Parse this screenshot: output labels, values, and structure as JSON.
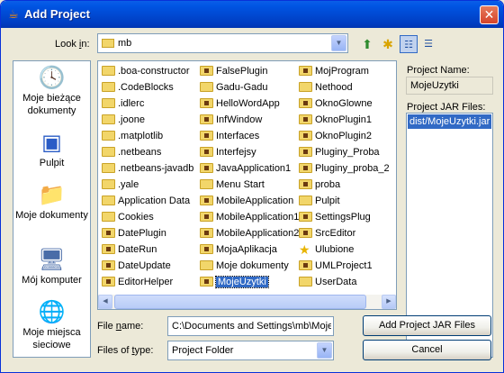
{
  "window": {
    "title": "Add Project",
    "close_symbol": "✕"
  },
  "lookin": {
    "label": "Look in:",
    "label_ul": "i",
    "value": "mb"
  },
  "places": [
    {
      "icon": "recent-documents-icon",
      "label": "Moje bieżące dokumenty"
    },
    {
      "icon": "desktop-icon",
      "label": "Pulpit"
    },
    {
      "icon": "my-documents-icon",
      "label": "Moje dokumenty"
    },
    {
      "icon": "my-computer-icon",
      "label": "Mój komputer"
    },
    {
      "icon": "network-places-icon",
      "label": "Moje miejsca sieciowe"
    }
  ],
  "files": {
    "col1": [
      {
        "name": ".boa-constructor",
        "icon": "folder"
      },
      {
        "name": ".CodeBlocks",
        "icon": "folder"
      },
      {
        "name": ".idlerc",
        "icon": "folder"
      },
      {
        "name": ".joone",
        "icon": "folder"
      },
      {
        "name": ".matplotlib",
        "icon": "folder"
      },
      {
        "name": ".netbeans",
        "icon": "folder"
      },
      {
        "name": ".netbeans-javadb",
        "icon": "folder"
      },
      {
        "name": ".yale",
        "icon": "folder"
      },
      {
        "name": "Application Data",
        "icon": "folder"
      },
      {
        "name": "Cookies",
        "icon": "folder"
      },
      {
        "name": "DatePlugin",
        "icon": "project"
      },
      {
        "name": "DateRun",
        "icon": "project"
      },
      {
        "name": "DateUpdate",
        "icon": "project"
      },
      {
        "name": "EditorHelper",
        "icon": "project"
      }
    ],
    "col2": [
      {
        "name": "FalsePlugin",
        "icon": "project"
      },
      {
        "name": "Gadu-Gadu",
        "icon": "folder"
      },
      {
        "name": "HelloWordApp",
        "icon": "project"
      },
      {
        "name": "InfWindow",
        "icon": "project"
      },
      {
        "name": "Interfaces",
        "icon": "project"
      },
      {
        "name": "Interfejsy",
        "icon": "project"
      },
      {
        "name": "JavaApplication1",
        "icon": "project"
      },
      {
        "name": "Menu Start",
        "icon": "folder"
      },
      {
        "name": "MobileApplication",
        "icon": "project"
      },
      {
        "name": "MobileApplication1",
        "icon": "project"
      },
      {
        "name": "MobileApplication2",
        "icon": "project"
      },
      {
        "name": "MojaAplikacja",
        "icon": "project"
      },
      {
        "name": "Moje dokumenty",
        "icon": "folder"
      },
      {
        "name": "MojeUzytki",
        "icon": "project",
        "selected": true
      }
    ],
    "col3": [
      {
        "name": "MojProgram",
        "icon": "project"
      },
      {
        "name": "Nethood",
        "icon": "folder"
      },
      {
        "name": "OknoGlowne",
        "icon": "project"
      },
      {
        "name": "OknoPlugin1",
        "icon": "project"
      },
      {
        "name": "OknoPlugin2",
        "icon": "project"
      },
      {
        "name": "Pluginy_Proba",
        "icon": "project"
      },
      {
        "name": "Pluginy_proba_2",
        "icon": "project"
      },
      {
        "name": "proba",
        "icon": "project"
      },
      {
        "name": "Pulpit",
        "icon": "folder"
      },
      {
        "name": "SettingsPlug",
        "icon": "project"
      },
      {
        "name": "SrcEditor",
        "icon": "project"
      },
      {
        "name": "Ulubione",
        "icon": "star"
      },
      {
        "name": "UMLProject1",
        "icon": "project"
      },
      {
        "name": "UserData",
        "icon": "folder"
      }
    ]
  },
  "filename": {
    "label": "File name:",
    "label_ul": "n",
    "value": "C:\\Documents and Settings\\mb\\MojeUzytki"
  },
  "filetype": {
    "label": "Files of type:",
    "label_ul": "t",
    "value": "Project Folder"
  },
  "project_name": {
    "label": "Project Name:",
    "value": "MojeUzytki"
  },
  "project_jars": {
    "label": "Project JAR Files:",
    "items": [
      "dist/MojeUzytki.jar"
    ]
  },
  "buttons": {
    "add_jar": "Add Project JAR Files",
    "cancel": "Cancel"
  },
  "colors": {
    "titlebar": "#0054e3",
    "selection": "#316ac5",
    "dialog_bg": "#ece9d8"
  }
}
